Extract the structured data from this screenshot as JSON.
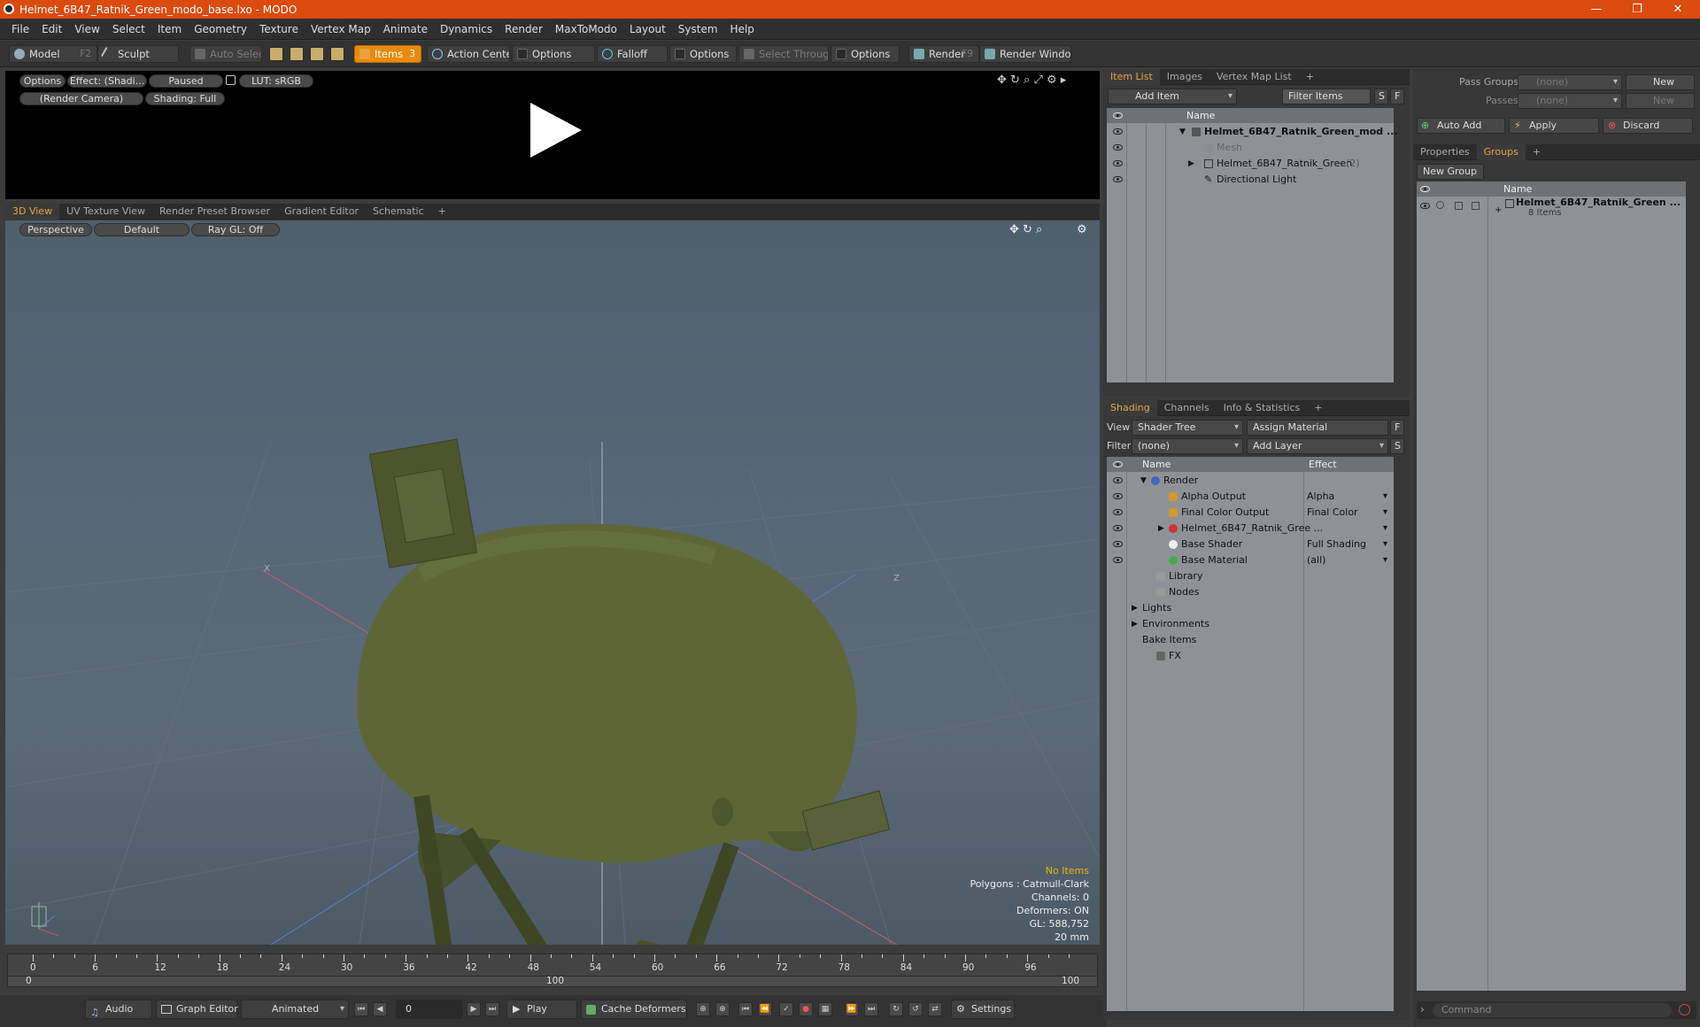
{
  "window": {
    "title": "Helmet_6B47_Ratnik_Green_modo_base.lxo - MODO",
    "minimize": "—",
    "restore": "❐",
    "close": "✕"
  },
  "menu": [
    "File",
    "Edit",
    "View",
    "Select",
    "Item",
    "Geometry",
    "Texture",
    "Vertex Map",
    "Animate",
    "Dynamics",
    "Render",
    "MaxToModo",
    "Layout",
    "System",
    "Help"
  ],
  "toolbar": {
    "model": "Model",
    "model_key": "F2",
    "sculpt": "Sculpt",
    "auto_select": "Auto Select",
    "items": "Items",
    "items_key": "3",
    "action_center": "Action Center",
    "options1": "Options",
    "falloff": "Falloff",
    "options2": "Options",
    "select_through": "Select Through",
    "options3": "Options",
    "render": "Render",
    "render_key": "F9",
    "render_window": "Render Window"
  },
  "preview": {
    "options": "Options",
    "effect": "Effect: (Shadi...",
    "paused": "Paused",
    "lut": "LUT: sRGB",
    "camera": "(Render Camera)",
    "shading": "Shading: Full"
  },
  "viewport": {
    "tabs": [
      "3D View",
      "UV Texture View",
      "Render Preset Browser",
      "Gradient Editor",
      "Schematic"
    ],
    "perspective": "Perspective",
    "default": "Default",
    "raygl": "Ray GL: Off",
    "stats": {
      "no_items": "No Items",
      "polygons": "Polygons : Catmull-Clark",
      "channels": "Channels: 0",
      "deformers": "Deformers: ON",
      "gl": "GL: 588,752",
      "scale": "20 mm"
    },
    "axis_x": "X",
    "axis_z": "Z"
  },
  "timeline": {
    "ticks": [
      "0",
      "6",
      "12",
      "18",
      "24",
      "30",
      "36",
      "42",
      "48",
      "54",
      "60",
      "66",
      "72",
      "78",
      "84",
      "90",
      "96"
    ],
    "range_start": "0",
    "range_mid": "100",
    "range_end": "100"
  },
  "bottombar": {
    "audio": "Audio",
    "graph_editor": "Graph Editor",
    "animated": "Animated",
    "frame": "0",
    "play": "Play",
    "cache_deformers": "Cache Deformers",
    "settings": "Settings"
  },
  "itemlist": {
    "tabs": [
      "Item List",
      "Images",
      "Vertex Map List"
    ],
    "add_item": "Add Item",
    "filter_items": "Filter Items",
    "s": "S",
    "f": "F",
    "name_col": "Name",
    "rows": [
      {
        "label": "Helmet_6B47_Ratnik_Green_mod ..."
      },
      {
        "label": "Mesh"
      },
      {
        "label": "Helmet_6B47_Ratnik_Green",
        "count": "(2)"
      },
      {
        "label": "Directional Light"
      }
    ]
  },
  "shading": {
    "tabs": [
      "Shading",
      "Channels",
      "Info & Statistics"
    ],
    "view_label": "View",
    "view_value": "Shader Tree",
    "assign_material": "Assign Material",
    "f": "F",
    "filter_label": "Filter",
    "filter_value": "(none)",
    "add_layer": "Add Layer",
    "s": "S",
    "name_col": "Name",
    "effect_col": "Effect",
    "rows": [
      {
        "name": "Render",
        "effect": ""
      },
      {
        "name": "Alpha Output",
        "effect": "Alpha"
      },
      {
        "name": "Final Color Output",
        "effect": "Final Color"
      },
      {
        "name": "Helmet_6B47_Ratnik_Gree ...",
        "effect": ""
      },
      {
        "name": "Base Shader",
        "effect": "Full Shading"
      },
      {
        "name": "Base Material",
        "effect": "(all)"
      },
      {
        "name": "Library",
        "effect": ""
      },
      {
        "name": "Nodes",
        "effect": ""
      },
      {
        "name": "Lights",
        "effect": ""
      },
      {
        "name": "Environments",
        "effect": ""
      },
      {
        "name": "Bake Items",
        "effect": ""
      },
      {
        "name": "FX",
        "effect": ""
      }
    ]
  },
  "groups": {
    "pass_groups_label": "Pass Groups",
    "pass_groups_value": "(none)",
    "new1": "New",
    "passes_label": "Passes",
    "passes_value": "(none)",
    "new2": "New",
    "auto_add": "Auto Add",
    "apply": "Apply",
    "discard": "Discard",
    "tabs": [
      "Properties",
      "Groups"
    ],
    "new_group": "New Group",
    "name_col": "Name",
    "item_name": "Helmet_6B47_Ratnik_Green ...",
    "item_count": "8 Items",
    "command": "Command"
  },
  "colors": {
    "accent": "#e88a0c",
    "title_bar": "#db4a0f",
    "helmet": "#5a6233"
  }
}
